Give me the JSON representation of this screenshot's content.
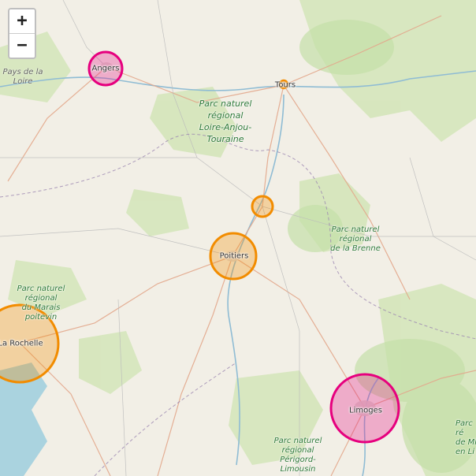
{
  "map": {
    "zoom_in_label": "+",
    "zoom_out_label": "−",
    "colors": {
      "magenta": "#e6007e",
      "orange": "#f28c00",
      "land": "#f2efe6",
      "forest": "#cfe3b3",
      "water": "#aad3df"
    },
    "cities": {
      "angers": "Angers",
      "tours": "Tours",
      "poitiers": "Poitiers",
      "la_rochelle": "La Rochelle",
      "limoges": "Limoges"
    },
    "regions": {
      "pays_de_la_loire_1": "Pays de la",
      "pays_de_la_loire_2": "Loire"
    },
    "parks": {
      "loire_anjou": [
        "Parc naturel",
        "régional",
        "Loire-Anjou-",
        "Touraine"
      ],
      "brenne": [
        "Parc naturel",
        "régional",
        "de la Brenne"
      ],
      "marais": [
        "Parc naturel",
        "régional",
        "du Marais",
        "poitevin"
      ],
      "perigord": [
        "Parc naturel",
        "régional",
        "Périgord-",
        "Limousin"
      ],
      "edge_right": [
        "Parc",
        "ré",
        "de Mi",
        "en Li"
      ]
    }
  }
}
